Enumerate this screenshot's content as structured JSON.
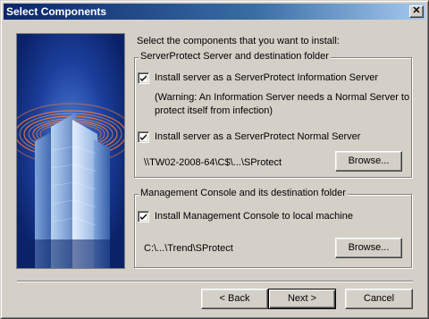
{
  "window": {
    "title": "Select Components",
    "close_glyph": "✕"
  },
  "banner": {
    "image": "serverprotect-building-graphic"
  },
  "intro": "Select the components that you want to install:",
  "server_group": {
    "label": "ServerProtect Server and destination folder",
    "info_server": {
      "label": "Install server as a ServerProtect Information Server",
      "checked": true
    },
    "warning_line1": "(Warning: An Information Server needs a Normal Server to",
    "warning_line2": "protect itself from infection)",
    "normal_server": {
      "label": "Install server as a ServerProtect Normal Server",
      "checked": true
    },
    "path": "\\\\TW02-2008-64\\C$\\...\\SProtect",
    "browse_label": "Browse..."
  },
  "console_group": {
    "label": "Management Console and its destination folder",
    "install_console": {
      "label": "Install Management Console to local machine",
      "checked": true
    },
    "path": "C:\\...\\Trend\\SProtect",
    "browse_label": "Browse..."
  },
  "footer": {
    "back_label": "< Back",
    "next_label": "Next >",
    "cancel_label": "Cancel"
  },
  "colors": {
    "titlebar_start": "#0a246a",
    "titlebar_end": "#a6caf0",
    "face": "#d4d0c8"
  }
}
